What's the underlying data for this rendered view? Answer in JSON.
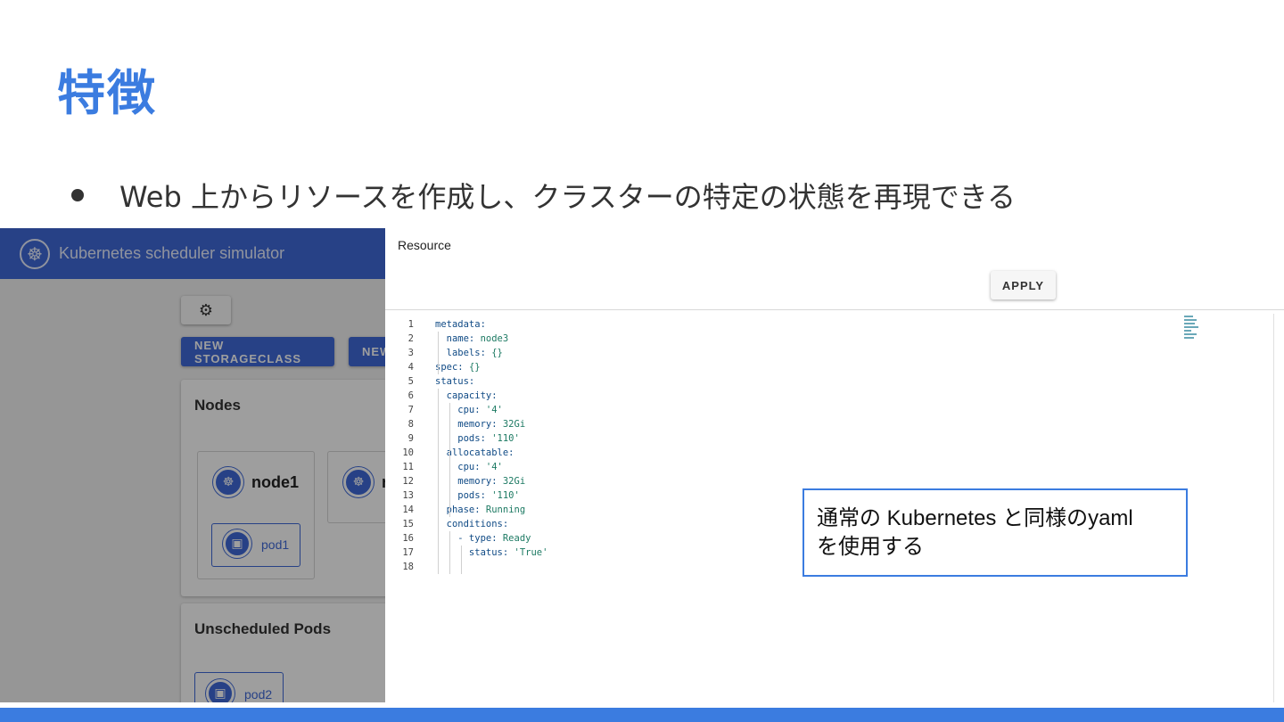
{
  "slide": {
    "title": "特徴",
    "bullet": "Web 上からリソースを作成し、クラスターの特定の状態を再現できる",
    "callout": "通常の Kubernetes と同様のyaml\nを使用する"
  },
  "app": {
    "title": "Kubernetes scheduler simulator",
    "logo_icon": "kubernetes-wheel-icon",
    "settings_icon": "gear-icon",
    "new_storageclass_label": "NEW STORAGECLASS",
    "new_other_label": "NEW",
    "nodes_title": "Nodes",
    "unscheduled_title": "Unscheduled Pods",
    "nodes": [
      {
        "label": "node1",
        "pods": [
          "pod1"
        ]
      },
      {
        "label": "n"
      }
    ],
    "unscheduled_pods": [
      "pod2"
    ]
  },
  "dialog": {
    "title": "Resource",
    "apply_label": "APPLY",
    "yaml_lines": [
      {
        "n": "1",
        "k": "metadata:",
        "v": ""
      },
      {
        "n": "2",
        "k": "  name: ",
        "v": "node3"
      },
      {
        "n": "3",
        "k": "  labels: ",
        "v": "{}"
      },
      {
        "n": "4",
        "k": "spec: ",
        "v": "{}"
      },
      {
        "n": "5",
        "k": "status:",
        "v": ""
      },
      {
        "n": "6",
        "k": "  capacity:",
        "v": ""
      },
      {
        "n": "7",
        "k": "    cpu: ",
        "v": "'4'"
      },
      {
        "n": "8",
        "k": "    memory: ",
        "v": "32Gi"
      },
      {
        "n": "9",
        "k": "    pods: ",
        "v": "'110'"
      },
      {
        "n": "10",
        "k": "  allocatable:",
        "v": ""
      },
      {
        "n": "11",
        "k": "    cpu: ",
        "v": "'4'"
      },
      {
        "n": "12",
        "k": "    memory: ",
        "v": "32Gi"
      },
      {
        "n": "13",
        "k": "    pods: ",
        "v": "'110'"
      },
      {
        "n": "14",
        "k": "  phase: ",
        "v": "Running"
      },
      {
        "n": "15",
        "k": "  conditions:",
        "v": ""
      },
      {
        "n": "16",
        "k": "    - type: ",
        "v": "Ready"
      },
      {
        "n": "17",
        "k": "      status: ",
        "v": "'True'"
      },
      {
        "n": "18",
        "k": "",
        "v": ""
      }
    ]
  },
  "colors": {
    "accent": "#3b7ce0",
    "appbar": "#3f6ad8",
    "yaml_key": "#0f4a85",
    "yaml_value": "#1d7a63"
  }
}
